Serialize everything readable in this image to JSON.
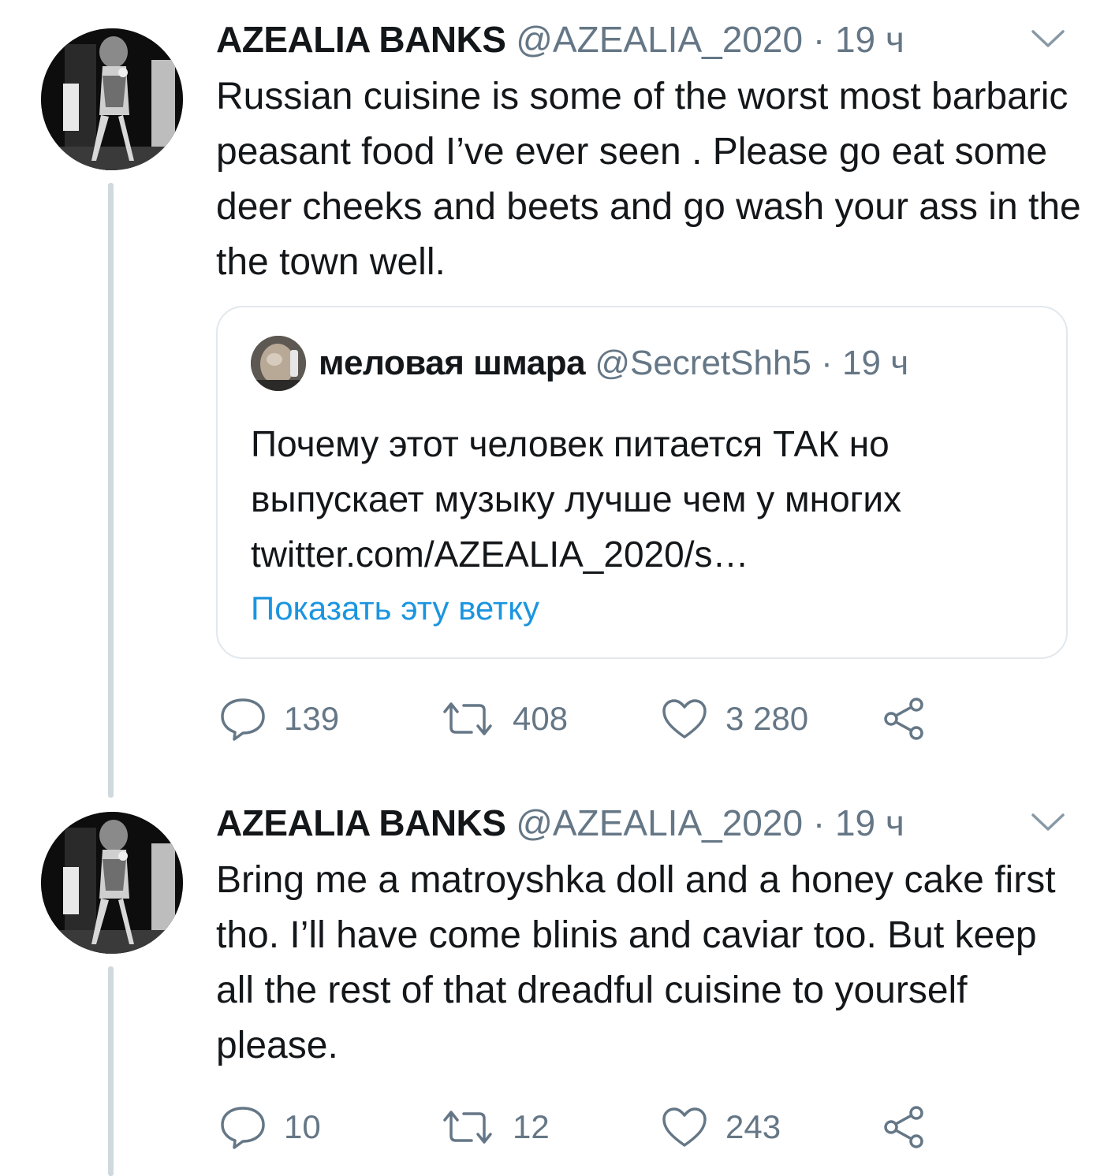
{
  "tweets": [
    {
      "author": {
        "name": "AZEALIA BANKS",
        "handle": "@AZEALIA_2020"
      },
      "time": "19 ч",
      "separator": "·",
      "text": "Russian cuisine is some of the worst most barbaric peasant food I’ve ever seen . Please go eat some deer cheeks and beets and go wash your ass in the the town well.",
      "quoted": {
        "author": {
          "name": "меловая шмара",
          "handle": "@SecretShh5"
        },
        "time": "19 ч",
        "text": "Почему этот человек питается ТАК но выпускает музыку лучше чем у многих",
        "link": "twitter.com/AZEALIA_2020/s…",
        "show_thread": "Показать эту ветку"
      },
      "stats": {
        "replies": "139",
        "retweets": "408",
        "likes": "3 280"
      }
    },
    {
      "author": {
        "name": "AZEALIA BANKS",
        "handle": "@AZEALIA_2020"
      },
      "time": "19 ч",
      "separator": "·",
      "text": "Bring me a matroyshka doll and a honey cake first tho. I’ll have come blinis and caviar too. But keep all the rest of that dreadful cuisine to yourself please.",
      "stats": {
        "replies": "10",
        "retweets": "12",
        "likes": "243"
      }
    }
  ],
  "icons": {
    "reply": "speech-bubble-icon",
    "retweet": "retweet-arrows-icon",
    "like": "heart-icon",
    "share": "share-nodes-icon",
    "menu": "chevron-down-icon"
  },
  "colors": {
    "text": "#14171a",
    "secondary": "#657786",
    "link": "#1b95e0",
    "thread_line": "#cfd9de",
    "border": "#e1e8ed"
  }
}
